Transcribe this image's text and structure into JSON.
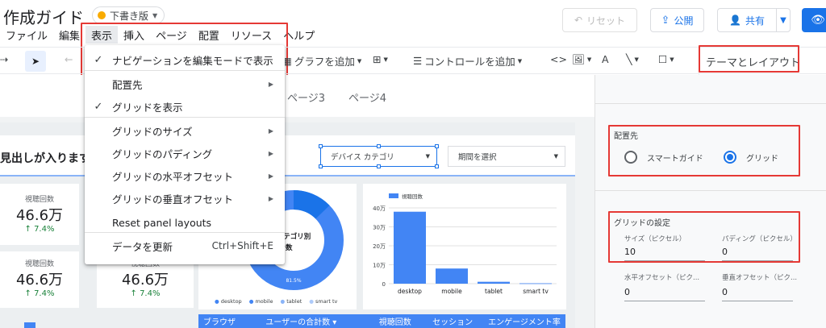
{
  "app": {
    "title": "作成ガイド",
    "status_badge": "下書き版",
    "status_color": "#f9ab00",
    "accent_color": "#1a73e8"
  },
  "menubar": [
    "ファイル",
    "編集",
    "表示",
    "挿入",
    "ページ",
    "配置",
    "リソース",
    "ヘルプ"
  ],
  "menubar_active": "表示",
  "header_buttons": {
    "reset": "リセット",
    "publish": "公開",
    "share": "共有"
  },
  "toolbar": {
    "add_chart": "グラフを追加",
    "add_control": "コントロールを追加",
    "code_icon": "<>",
    "theme_layout": "テーマとレイアウト"
  },
  "view_menu": {
    "items": [
      {
        "label": "ナビゲーションを編集モードで表示",
        "checked": true,
        "submenu": false
      },
      {
        "label": "配置先",
        "checked": false,
        "submenu": true
      },
      {
        "label": "グリッドを表示",
        "checked": true,
        "submenu": false
      },
      {
        "label": "グリッドのサイズ",
        "checked": false,
        "submenu": true
      },
      {
        "label": "グリッドのパディング",
        "checked": false,
        "submenu": true
      },
      {
        "label": "グリッドの水平オフセット",
        "checked": false,
        "submenu": true
      },
      {
        "label": "グリッドの垂直オフセット",
        "checked": false,
        "submenu": true
      },
      {
        "label": "Reset panel layouts",
        "checked": false,
        "submenu": false
      },
      {
        "label": "データを更新",
        "checked": false,
        "submenu": false,
        "shortcut": "Ctrl+Shift+E"
      }
    ]
  },
  "canvas": {
    "page_tabs": [
      "ページ3",
      "ページ4"
    ],
    "headline": "見出しが入ります",
    "controls": {
      "device_category": "デバイス カテゴリ",
      "period": "期間を選択"
    },
    "kpis": [
      {
        "label": "視聴回数",
        "value": "46.6万",
        "delta": "↑ 7.4%"
      },
      {
        "label": "視聴回数",
        "value": "46.6万",
        "delta": "↑ 7.4%"
      },
      {
        "label": "視聴回数",
        "value": "46.6万",
        "delta": "↑ 7.4%"
      }
    ],
    "donut": {
      "center_label": "カテゴリ別\nン数",
      "center_line1": "カテゴリ別",
      "center_line2": "ン数",
      "pct_label": "81.5%",
      "legend": [
        "desktop",
        "mobile",
        "tablet",
        "smart tv"
      ],
      "colors": [
        "#4285f4",
        "#4285f4",
        "#8ab4f8",
        "#aecbfa"
      ]
    },
    "bottom_legend_label": "視聴回数",
    "table_headers": [
      "ブラウザ",
      "ユーザーの合計数 ▾",
      "視聴回数",
      "セッション",
      "エンゲージメント率"
    ]
  },
  "chart_data": {
    "type": "bar",
    "categories": [
      "desktop",
      "mobile",
      "tablet",
      "smart tv"
    ],
    "series": [
      {
        "name": "視聴回数",
        "values": [
          38,
          8,
          1,
          0.2
        ]
      }
    ],
    "ylim": [
      0,
      40
    ],
    "yticks": [
      "40万",
      "30万",
      "20万",
      "10万",
      "0"
    ],
    "legend": "top-left",
    "color": "#4285f4"
  },
  "panel": {
    "placement_title": "配置先",
    "smart_guide": "スマートガイド",
    "grid": "グリッド",
    "grid_settings_title": "グリッドの設定",
    "size_label": "サイズ（ピクセル）",
    "size_value": "10",
    "padding_label": "パディング（ピクセル）",
    "padding_value": "0",
    "h_offset_label": "水平オフセット（ピク...",
    "h_offset_value": "0",
    "v_offset_label": "垂直オフセット（ピク...",
    "v_offset_value": "0"
  }
}
